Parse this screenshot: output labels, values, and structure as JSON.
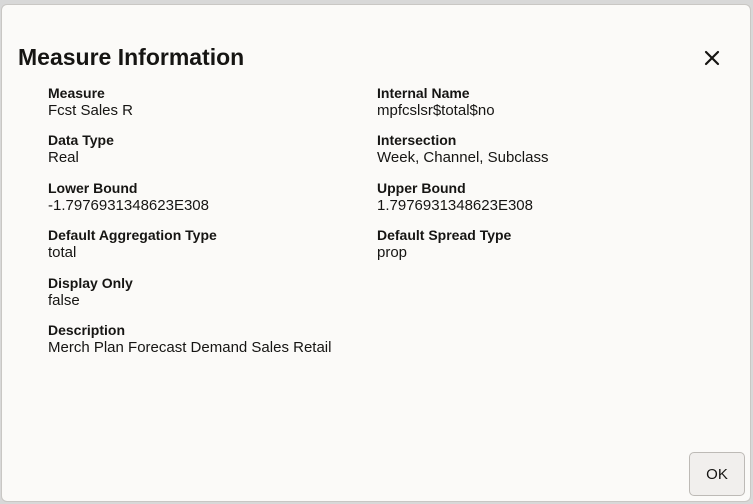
{
  "dialog": {
    "title": "Measure Information",
    "close_icon": "close-icon",
    "ok_label": "OK"
  },
  "fields": {
    "measure": {
      "label": "Measure",
      "value": "Fcst Sales R"
    },
    "internal_name": {
      "label": "Internal Name",
      "value": "mpfcslsr$total$no"
    },
    "data_type": {
      "label": "Data Type",
      "value": "Real"
    },
    "intersection": {
      "label": "Intersection",
      "value": "Week, Channel, Subclass"
    },
    "lower_bound": {
      "label": "Lower Bound",
      "value": "-1.7976931348623E308"
    },
    "upper_bound": {
      "label": "Upper Bound",
      "value": "1.7976931348623E308"
    },
    "default_aggregation_type": {
      "label": "Default Aggregation Type",
      "value": "total"
    },
    "default_spread_type": {
      "label": "Default Spread Type",
      "value": "prop"
    },
    "display_only": {
      "label": "Display Only",
      "value": "false"
    },
    "description": {
      "label": "Description",
      "value": "Merch Plan Forecast Demand Sales Retail"
    }
  },
  "colors": {
    "text": "#161513",
    "dialog_background": "#fbfaf8",
    "button_background": "#f1efed"
  }
}
